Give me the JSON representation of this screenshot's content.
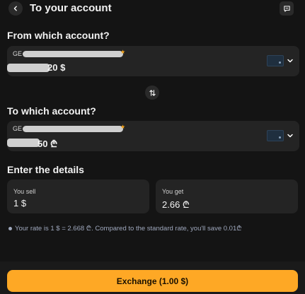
{
  "header": {
    "title": "To your account",
    "back_icon": "chevron-left-icon",
    "chat_icon": "chat-icon"
  },
  "from": {
    "section_title": "From which account?",
    "account_prefix": "GE",
    "balance_visible": "20 $",
    "star_color": "#f7a51b"
  },
  "swap_icon": "swap-vertical-icon",
  "to": {
    "section_title": "To which account?",
    "account_prefix": "GE",
    "balance_visible": "50 ₾",
    "star_color": "#f7a51b"
  },
  "details": {
    "section_title": "Enter the details",
    "sell_label": "You sell",
    "sell_value": "1 $",
    "get_label": "You get",
    "get_value": "2.66 ₾"
  },
  "rate_note": "Your rate is 1 $ = 2.668 ₾. Compared to the standard rate, you'll save 0.01₾",
  "exchange_button": {
    "label": "Exchange (1.00 $)",
    "color": "#fea825"
  }
}
